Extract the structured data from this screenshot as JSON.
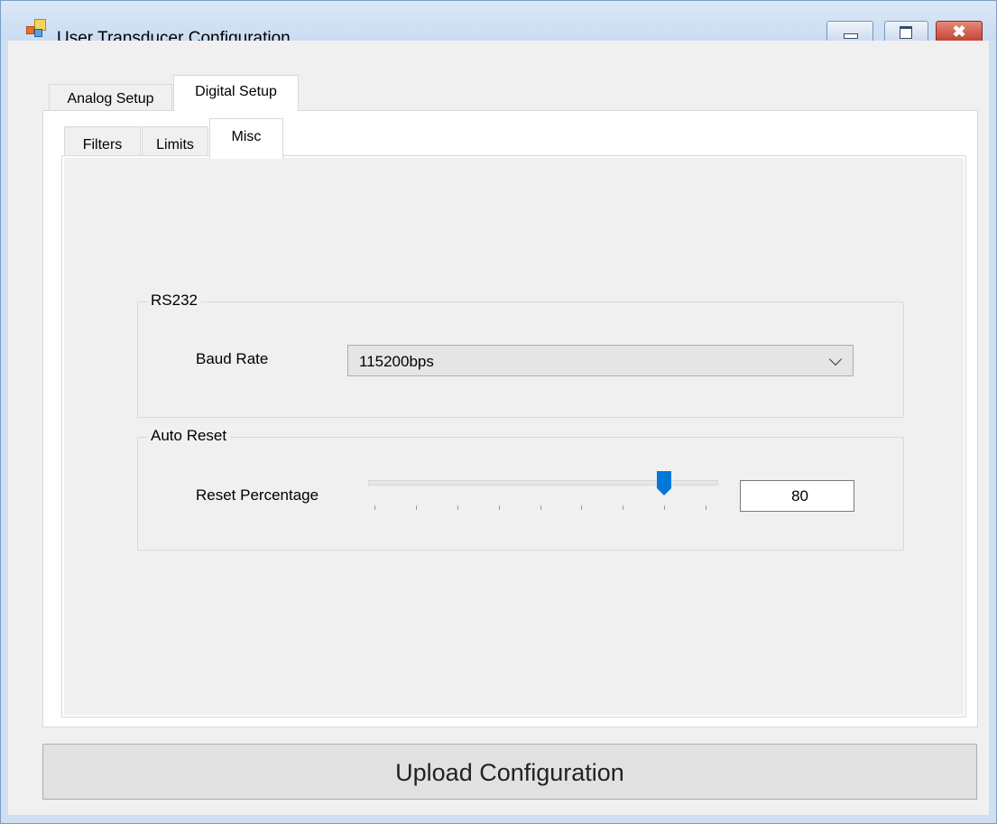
{
  "window": {
    "title": "User Transducer Configuration",
    "buttons": {
      "minimize": "minimize",
      "maximize": "maximize",
      "close": "✖"
    }
  },
  "outer_tabs": {
    "items": [
      "Analog Setup",
      "Digital Setup"
    ],
    "active": "Digital Setup"
  },
  "inner_tabs": {
    "items": [
      "Filters",
      "Limits",
      "Misc"
    ],
    "active": "Misc"
  },
  "rs232": {
    "legend": "RS232",
    "baud_label": "Baud Rate",
    "baud_value": "115200bps"
  },
  "auto_reset": {
    "legend": "Auto Reset",
    "reset_label": "Reset Percentage",
    "slider": {
      "min": 10,
      "max": 90,
      "step": 10,
      "value": 80,
      "ticks": 9
    },
    "percentage_value": "80"
  },
  "upload_label": "Upload Configuration",
  "colors": {
    "accent": "#0078d7",
    "titlebar": "#cfdff2",
    "close": "#c0392b"
  }
}
